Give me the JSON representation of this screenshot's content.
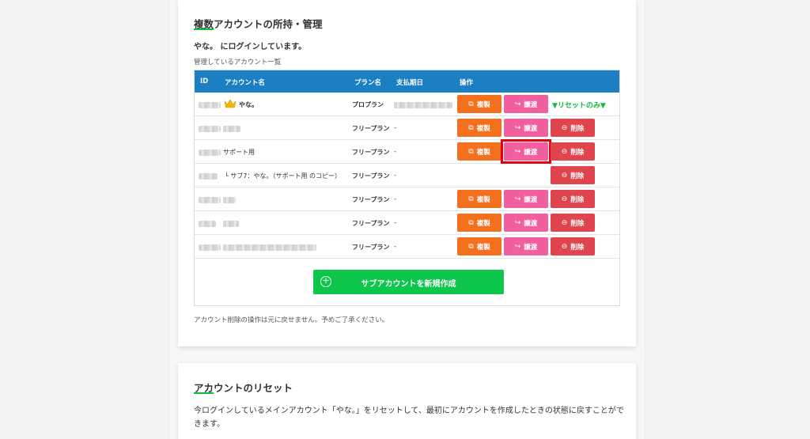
{
  "section1": {
    "title": "複数アカウントの所持・管理",
    "login_message": "やな。 にログインしています。",
    "list_label": "管理しているアカウント一覧",
    "table": {
      "headers": {
        "id": "ID",
        "account_name": "アカウント名",
        "plan": "プラン名",
        "due_date": "支払期日",
        "actions": "操作"
      },
      "rows": [
        {
          "name": "やな。",
          "plan": "プロプラン",
          "due": "",
          "crown": true
        },
        {
          "name": "",
          "plan": "フリープラン",
          "due": "-"
        },
        {
          "name": "サポート用",
          "plan": "フリープラン",
          "due": "-"
        },
        {
          "name": "└ サブ7：やな。（サポート用 のコピー）",
          "plan": "フリープラン",
          "due": "-"
        },
        {
          "name": "",
          "plan": "フリープラン",
          "due": "-"
        },
        {
          "name": "",
          "plan": "フリープラン",
          "due": "-"
        },
        {
          "name": "",
          "plan": "フリープラン",
          "due": "-"
        }
      ]
    },
    "buttons": {
      "copy": "複製",
      "transfer": "譲渡",
      "delete": "削除",
      "reset_only": "▼リセットのみ▼"
    },
    "create_sub_account": "サブアカウントを新規作成",
    "note": "アカウント削除の操作は元に戻せません。予めご了承ください。"
  },
  "section2": {
    "title": "アカウントのリセット",
    "description": "今ログインしているメインアカウント「やな。」をリセットして、最初にアカウントを作成したときの状態に戻すことができます。"
  },
  "colors": {
    "header_blue": "#1b7fc2",
    "copy_orange": "#f3701e",
    "transfer_pink": "#f25f9e",
    "delete_red": "#e0454e",
    "accent_green": "#10b93f",
    "highlight_red": "#e0000f"
  }
}
